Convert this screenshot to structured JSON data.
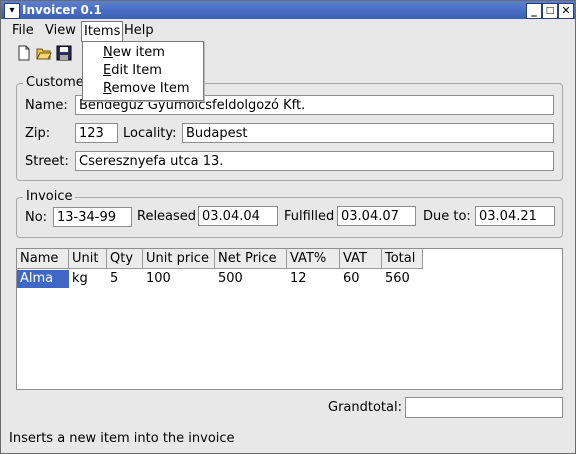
{
  "window": {
    "title": "Invoicer 0.1"
  },
  "menubar": {
    "file": "File",
    "view": "View",
    "items": "Items",
    "help": "Help"
  },
  "items_menu": [
    {
      "first": "N",
      "rest": "ew item"
    },
    {
      "first": "E",
      "rest": "dit Item"
    },
    {
      "first": "R",
      "rest": "emove Item"
    }
  ],
  "customer": {
    "legend": "Custome",
    "name_label": "Name:",
    "name_value": "Bendegúz Gyümölcsfeldolgozó Kft.",
    "zip_label": "Zip:",
    "zip_value": "123",
    "locality_label": "Locality:",
    "locality_value": "Budapest",
    "street_label": "Street:",
    "street_value": "Cseresznyefa utca 13."
  },
  "invoice": {
    "legend": "Invoice",
    "no_label": "No:",
    "no_value": "13-34-99",
    "released_label": "Released",
    "released_value": "03.04.04",
    "fulfilled_label": "Fulfilled",
    "fulfilled_value": "03.04.07",
    "dueto_label": "Due to:",
    "dueto_value": "03.04.21"
  },
  "table": {
    "columns": [
      "Name",
      "Unit",
      "Qty",
      "Unit price",
      "Net Price",
      "VAT%",
      "VAT",
      "Total"
    ],
    "rows": [
      [
        "Alma",
        "kg",
        "5",
        "100",
        "500",
        "12",
        "60",
        "560"
      ]
    ]
  },
  "footer": {
    "grandtotal_label": "Grandtotal:",
    "grandtotal_value": ""
  },
  "status": {
    "text": "Inserts a new item into the invoice"
  }
}
